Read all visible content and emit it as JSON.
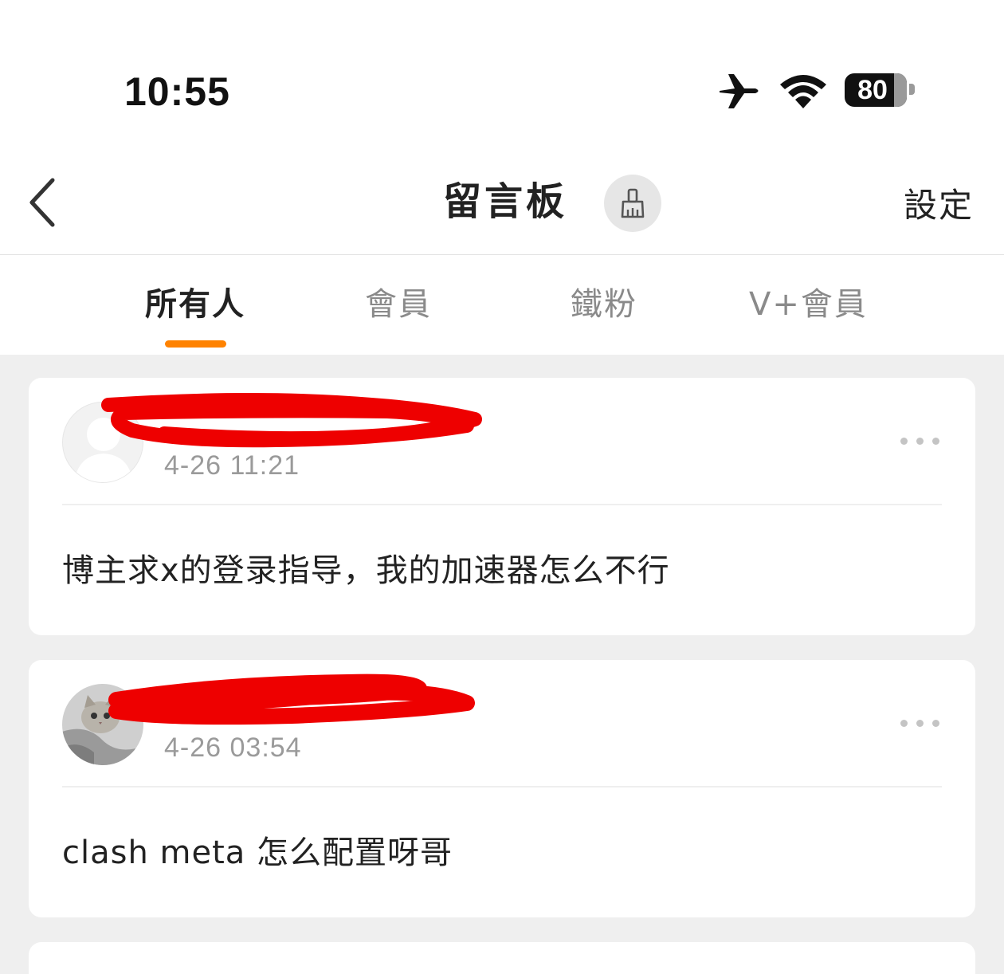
{
  "status_bar": {
    "time": "10:55",
    "battery_level": "80",
    "battery_percent": 80,
    "icons": [
      "airplane-mode-icon",
      "wifi-icon",
      "battery-icon"
    ]
  },
  "nav": {
    "title": "留言板",
    "settings_label": "設定",
    "icons": [
      "back-chevron-icon",
      "broom-icon"
    ]
  },
  "tabs": [
    {
      "label": "所有人",
      "active": true
    },
    {
      "label": "會員",
      "active": false
    },
    {
      "label": "鐵粉",
      "active": false
    },
    {
      "label": "V+會員",
      "active": false
    }
  ],
  "colors": {
    "accent": "#ff8200",
    "redaction": "#ee0000",
    "background": "#efefef"
  },
  "posts": [
    {
      "avatar": "default-avatar",
      "timestamp": "4-26 11:21",
      "message": "博主求x的登录指导，我的加速器怎么不行"
    },
    {
      "avatar": "cat-photo-avatar",
      "timestamp": "4-26 03:54",
      "message": "clash meta 怎么配置呀哥"
    }
  ]
}
